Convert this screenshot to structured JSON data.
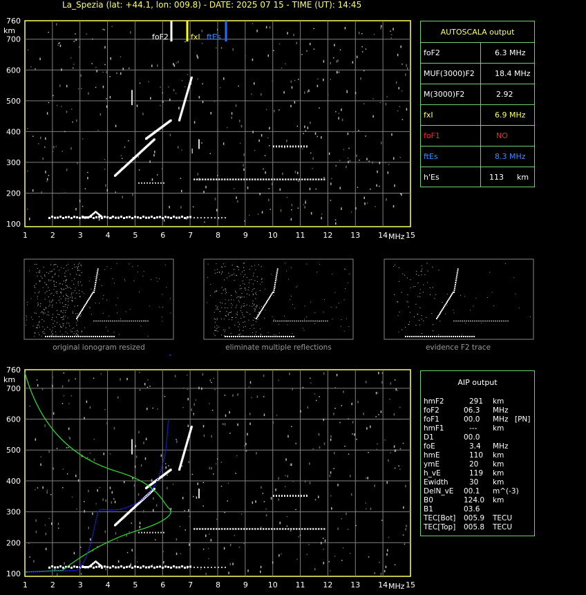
{
  "title": "La_Spezia (lat: +44.1, lon: 009.8) - DATE: 2025 07 15 - TIME (UT): 14:45",
  "colors": {
    "grid": "#808080",
    "frame": "#ffff66",
    "panel": "#6fd36f",
    "foF2": "#ffffff",
    "fxI": "#ffff00",
    "ftEs": "#1e6fff",
    "profile": "#2dd42d",
    "trace": "#1c1cff"
  },
  "axes": {
    "km_label": "km",
    "mhz_label": "MHz",
    "y_ticks": [
      "760",
      "700",
      "600",
      "500",
      "400",
      "300",
      "200",
      "100"
    ],
    "x_ticks": [
      "1",
      "2",
      "3",
      "4",
      "5",
      "6",
      "7",
      "8",
      "9",
      "10",
      "11",
      "12",
      "13",
      "14",
      "15"
    ]
  },
  "markers": {
    "foF2": "foF2",
    "fxI": "fxI",
    "ftEs": "ftEs"
  },
  "autoscala": {
    "title": "AUTOSCALA output",
    "rows": [
      {
        "label": "foF2",
        "value": "6.3 MHz",
        "label_color": "#ffffff",
        "value_color": "#ffffff"
      },
      {
        "label": "MUF(3000)F2",
        "value": "18.4 MHz",
        "label_color": "#ffffff",
        "value_color": "#ffffff"
      },
      {
        "label": "M(3000)F2",
        "value": "2.92",
        "label_color": "#ffffff",
        "value_color": "#ffffff"
      },
      {
        "label": "fxI",
        "value": "6.9 MHz",
        "label_color": "#ffff66",
        "value_color": "#ffff66"
      },
      {
        "label": "foF1",
        "value": "NO",
        "label_color": "#ff2020",
        "value_color": "#ff2020"
      },
      {
        "label": "ftEs",
        "value": "8.3 MHz",
        "label_color": "#3b8cff",
        "value_color": "#3b8cff"
      },
      {
        "label": "h'Es",
        "value": "113",
        "unit": "km",
        "label_color": "#ffffff",
        "value_color": "#ffffff"
      }
    ]
  },
  "captions": [
    "original ionogram resized",
    "eliminate multiple reflections",
    "evidence F2 trace"
  ],
  "aip": {
    "title": "AIP output",
    "rows": [
      [
        "hmF2",
        "291",
        "km",
        ""
      ],
      [
        "foF2",
        "06.3",
        "MHz",
        ""
      ],
      [
        "foF1",
        "00.0",
        "MHz",
        "[PN]"
      ],
      [
        "hmF1",
        "---",
        "km",
        ""
      ],
      [
        "D1",
        "00.0",
        "",
        ""
      ],
      [
        "foE",
        "3.4",
        "MHz",
        ""
      ],
      [
        "hmE",
        "110",
        "km",
        ""
      ],
      [
        "ymE",
        "20",
        "km",
        ""
      ],
      [
        "h_vE",
        "119",
        "km",
        ""
      ],
      [
        "Ewidth",
        "30",
        "km",
        ""
      ],
      [
        "DelN_vE",
        "00.1",
        "m^(-3)",
        ""
      ],
      [
        "B0",
        "124.0",
        "km",
        ""
      ],
      [
        "B1",
        "03.6",
        "",
        ""
      ],
      [
        "TEC[Bot]",
        "005.9",
        "TECU",
        ""
      ],
      [
        "TEC[Top]",
        "005.8",
        "TECU",
        ""
      ]
    ]
  }
}
